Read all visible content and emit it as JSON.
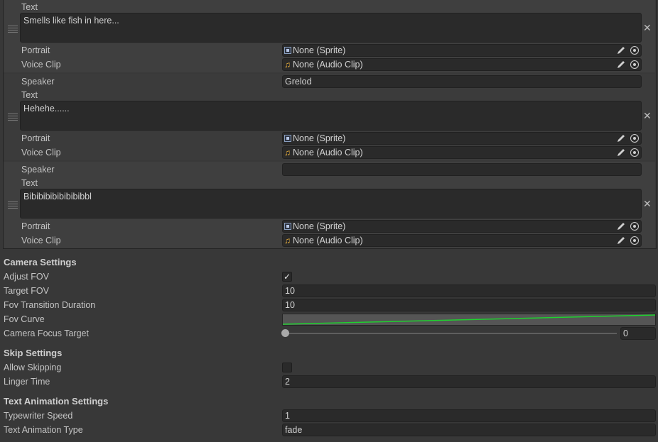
{
  "dialogue_lines": [
    {
      "speaker": null,
      "text": "Smells like fish in here...",
      "portrait": "None (Sprite)",
      "voice_clip": "None (Audio Clip)"
    },
    {
      "speaker": "Grelod",
      "text": "Hehehe......",
      "portrait": "None (Sprite)",
      "voice_clip": "None (Audio Clip)"
    },
    {
      "speaker": "",
      "text": "Bibibibibibibibibbl",
      "portrait": "None (Sprite)",
      "voice_clip": "None (Audio Clip)"
    }
  ],
  "labels": {
    "speaker": "Speaker",
    "text": "Text",
    "portrait": "Portrait",
    "voice_clip": "Voice Clip"
  },
  "camera_settings": {
    "header": "Camera Settings",
    "adjust_fov_label": "Adjust FOV",
    "adjust_fov_checked": true,
    "check_mark": "✓",
    "target_fov_label": "Target FOV",
    "target_fov": "10",
    "fov_transition_duration_label": "Fov Transition Duration",
    "fov_transition_duration": "10",
    "fov_curve_label": "Fov Curve",
    "fov_curve_color": "#1fd12f",
    "camera_focus_target_label": "Camera Focus Target",
    "camera_focus_target": "0",
    "camera_focus_target_fraction": 0
  },
  "skip_settings": {
    "header": "Skip Settings",
    "allow_skipping_label": "Allow Skipping",
    "allow_skipping_checked": false,
    "linger_time_label": "Linger Time",
    "linger_time": "2"
  },
  "text_animation_settings": {
    "header": "Text Animation Settings",
    "typewriter_speed_label": "Typewriter Speed",
    "typewriter_speed": "1",
    "text_animation_type_label": "Text Animation Type",
    "text_animation_type": "fade"
  },
  "icons": {
    "drag_handle": "drag-handle-icon",
    "remove": "close-icon",
    "remove_glyph": "✕",
    "audio_glyph": "♫",
    "sprite": "sprite-icon",
    "edit": "pencil-icon",
    "picker": "object-picker-icon"
  }
}
